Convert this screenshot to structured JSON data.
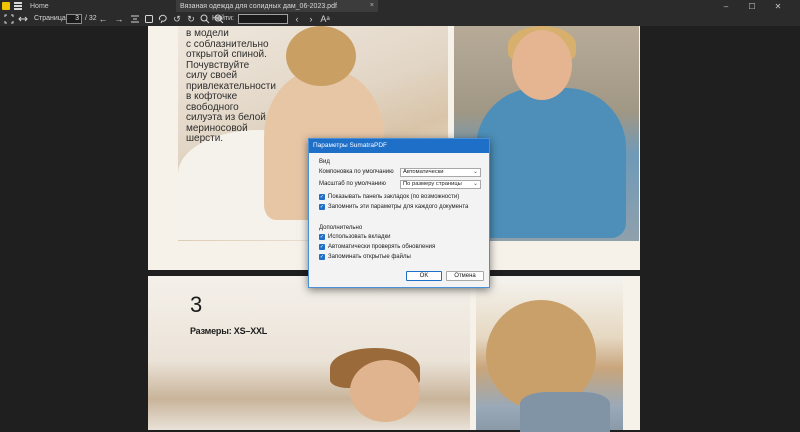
{
  "titlebar": {
    "tabs": [
      {
        "label": "Home"
      },
      {
        "label": "Вязаная одежда для солидных дам_06-2023.pdf"
      }
    ],
    "tab_close": "×",
    "min": "–",
    "max": "☐",
    "close": "✕"
  },
  "toolbar": {
    "page_label": "Страница:",
    "page_value": "3",
    "page_total": "/ 32",
    "find_label": "Найти:"
  },
  "page": {
    "text_block": "в модели\nс соблазнительно\nоткрытой спиной.\nПочувствуйте\nсилу своей\nпривлекательности\nв кофточке\nсвободного\nсилуэта из белой\nмериносовой\nшерсти.",
    "number": "3",
    "sizes": "Размеры: XS–XXL"
  },
  "dialog": {
    "title": "Параметры SumatraPDF",
    "section_view": "Вид",
    "layout_label": "Компоновка по умолчанию",
    "layout_value": "Автоматически",
    "zoom_label": "Масштаб по умолчанию",
    "zoom_value": "По размеру страницы",
    "chk_bookmarks": "Показывать панель закладок (по возможности)",
    "chk_remember": "Запомнить эти параметры для каждого документа",
    "section_extra": "Дополнительно",
    "chk_tabs": "Использовать вкладки",
    "chk_updates": "Автоматически проверять обновления",
    "chk_files": "Запоминать открытые файлы",
    "ok": "OK",
    "cancel": "Отмена"
  },
  "colors": {
    "accent": "#1e6fc8",
    "logo": "#f2c400",
    "chrome": "#2b2b2b"
  }
}
